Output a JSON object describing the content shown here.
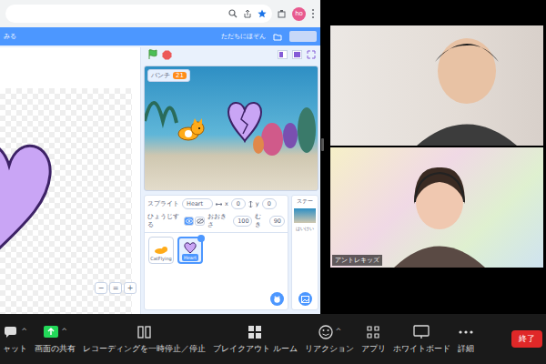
{
  "browser": {
    "avatar": "ho"
  },
  "scratch_menu": {
    "left_text": "みる",
    "save_now": "ただちにほぞん"
  },
  "paint_editor": {
    "zoom_buttons": [
      "−",
      "=",
      "+"
    ]
  },
  "stage": {
    "monitor": {
      "label": "パンチ",
      "value": "21"
    }
  },
  "sprite_info": {
    "sprite_label": "スプライト",
    "name": "Heart",
    "x_label": "x",
    "x": "0",
    "y_label": "y",
    "y": "0",
    "show_label": "ひょうじする",
    "visible": true,
    "size_label": "おおきさ",
    "size": "100",
    "direction_label": "むき",
    "direction": "90"
  },
  "sprites": [
    {
      "name": "CatFlying",
      "selected": false
    },
    {
      "name": "Heart",
      "selected": true
    }
  ],
  "stage_panel": {
    "label": "ステー",
    "backdrop_label": "はいけい"
  },
  "self_video": {
    "name": "アントレキッズ"
  },
  "zoom_toolbar": {
    "items": [
      {
        "label": "ャット",
        "icon": "chat",
        "caret": "^"
      },
      {
        "label": "画面の共有",
        "icon": "share",
        "caret": "^"
      },
      {
        "label": "レコーディングを一時停止／停止",
        "icon": "record"
      },
      {
        "label": "ブレイクアウト ルーム",
        "icon": "breakout"
      },
      {
        "label": "リアクション",
        "icon": "reaction",
        "caret": "^"
      },
      {
        "label": "アプリ",
        "icon": "apps"
      },
      {
        "label": "ホワイトボード",
        "icon": "whiteboard"
      },
      {
        "label": "詳細",
        "icon": "more"
      }
    ],
    "end": "終了"
  }
}
